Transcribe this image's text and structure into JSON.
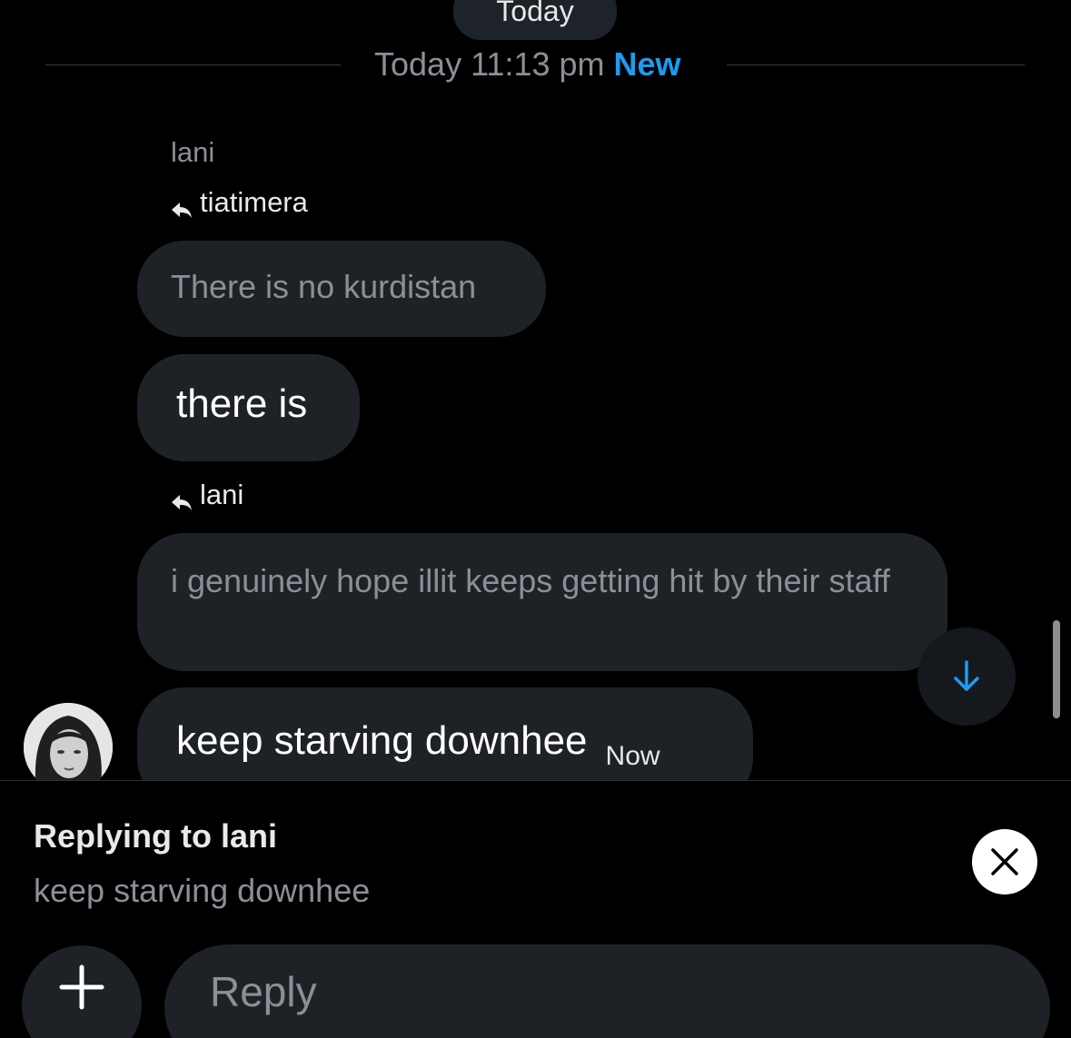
{
  "header": {
    "today_pill": "Today",
    "divider_time": "Today 11:13 pm",
    "divider_new": "New"
  },
  "conversation": {
    "sender_name": "lani",
    "messages": [
      {
        "reply_to": "tiatimera",
        "quoted_text": "There is no kurdistan",
        "text": "there is"
      },
      {
        "reply_to": "lani",
        "quoted_text": "i genuinely hope illit keeps getting hit by their staff",
        "text": "keep starving downhee",
        "timestamp": "Now"
      }
    ]
  },
  "composer": {
    "replying_title": "Replying to lani",
    "replying_text": "keep starving downhee",
    "input_placeholder": "Reply"
  },
  "icons": {
    "reply": "reply-arrow-icon",
    "scroll_down": "arrow-down-icon",
    "close": "close-icon",
    "add": "plus-icon"
  },
  "colors": {
    "background": "#000000",
    "bubble": "#1e2226",
    "accent": "#1d9bf0",
    "muted_text": "#8b9096"
  }
}
